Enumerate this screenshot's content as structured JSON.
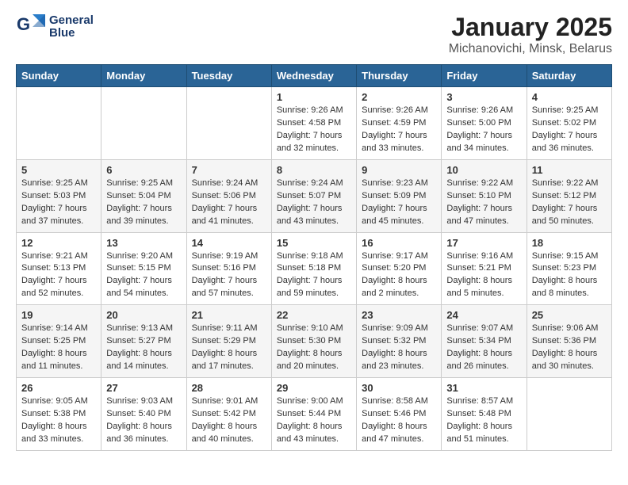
{
  "header": {
    "logo_line1": "General",
    "logo_line2": "Blue",
    "title": "January 2025",
    "subtitle": "Michanovichi, Minsk, Belarus"
  },
  "days_of_week": [
    "Sunday",
    "Monday",
    "Tuesday",
    "Wednesday",
    "Thursday",
    "Friday",
    "Saturday"
  ],
  "weeks": [
    [
      {
        "day": "",
        "content": ""
      },
      {
        "day": "",
        "content": ""
      },
      {
        "day": "",
        "content": ""
      },
      {
        "day": "1",
        "content": "Sunrise: 9:26 AM\nSunset: 4:58 PM\nDaylight: 7 hours\nand 32 minutes."
      },
      {
        "day": "2",
        "content": "Sunrise: 9:26 AM\nSunset: 4:59 PM\nDaylight: 7 hours\nand 33 minutes."
      },
      {
        "day": "3",
        "content": "Sunrise: 9:26 AM\nSunset: 5:00 PM\nDaylight: 7 hours\nand 34 minutes."
      },
      {
        "day": "4",
        "content": "Sunrise: 9:25 AM\nSunset: 5:02 PM\nDaylight: 7 hours\nand 36 minutes."
      }
    ],
    [
      {
        "day": "5",
        "content": "Sunrise: 9:25 AM\nSunset: 5:03 PM\nDaylight: 7 hours\nand 37 minutes."
      },
      {
        "day": "6",
        "content": "Sunrise: 9:25 AM\nSunset: 5:04 PM\nDaylight: 7 hours\nand 39 minutes."
      },
      {
        "day": "7",
        "content": "Sunrise: 9:24 AM\nSunset: 5:06 PM\nDaylight: 7 hours\nand 41 minutes."
      },
      {
        "day": "8",
        "content": "Sunrise: 9:24 AM\nSunset: 5:07 PM\nDaylight: 7 hours\nand 43 minutes."
      },
      {
        "day": "9",
        "content": "Sunrise: 9:23 AM\nSunset: 5:09 PM\nDaylight: 7 hours\nand 45 minutes."
      },
      {
        "day": "10",
        "content": "Sunrise: 9:22 AM\nSunset: 5:10 PM\nDaylight: 7 hours\nand 47 minutes."
      },
      {
        "day": "11",
        "content": "Sunrise: 9:22 AM\nSunset: 5:12 PM\nDaylight: 7 hours\nand 50 minutes."
      }
    ],
    [
      {
        "day": "12",
        "content": "Sunrise: 9:21 AM\nSunset: 5:13 PM\nDaylight: 7 hours\nand 52 minutes."
      },
      {
        "day": "13",
        "content": "Sunrise: 9:20 AM\nSunset: 5:15 PM\nDaylight: 7 hours\nand 54 minutes."
      },
      {
        "day": "14",
        "content": "Sunrise: 9:19 AM\nSunset: 5:16 PM\nDaylight: 7 hours\nand 57 minutes."
      },
      {
        "day": "15",
        "content": "Sunrise: 9:18 AM\nSunset: 5:18 PM\nDaylight: 7 hours\nand 59 minutes."
      },
      {
        "day": "16",
        "content": "Sunrise: 9:17 AM\nSunset: 5:20 PM\nDaylight: 8 hours\nand 2 minutes."
      },
      {
        "day": "17",
        "content": "Sunrise: 9:16 AM\nSunset: 5:21 PM\nDaylight: 8 hours\nand 5 minutes."
      },
      {
        "day": "18",
        "content": "Sunrise: 9:15 AM\nSunset: 5:23 PM\nDaylight: 8 hours\nand 8 minutes."
      }
    ],
    [
      {
        "day": "19",
        "content": "Sunrise: 9:14 AM\nSunset: 5:25 PM\nDaylight: 8 hours\nand 11 minutes."
      },
      {
        "day": "20",
        "content": "Sunrise: 9:13 AM\nSunset: 5:27 PM\nDaylight: 8 hours\nand 14 minutes."
      },
      {
        "day": "21",
        "content": "Sunrise: 9:11 AM\nSunset: 5:29 PM\nDaylight: 8 hours\nand 17 minutes."
      },
      {
        "day": "22",
        "content": "Sunrise: 9:10 AM\nSunset: 5:30 PM\nDaylight: 8 hours\nand 20 minutes."
      },
      {
        "day": "23",
        "content": "Sunrise: 9:09 AM\nSunset: 5:32 PM\nDaylight: 8 hours\nand 23 minutes."
      },
      {
        "day": "24",
        "content": "Sunrise: 9:07 AM\nSunset: 5:34 PM\nDaylight: 8 hours\nand 26 minutes."
      },
      {
        "day": "25",
        "content": "Sunrise: 9:06 AM\nSunset: 5:36 PM\nDaylight: 8 hours\nand 30 minutes."
      }
    ],
    [
      {
        "day": "26",
        "content": "Sunrise: 9:05 AM\nSunset: 5:38 PM\nDaylight: 8 hours\nand 33 minutes."
      },
      {
        "day": "27",
        "content": "Sunrise: 9:03 AM\nSunset: 5:40 PM\nDaylight: 8 hours\nand 36 minutes."
      },
      {
        "day": "28",
        "content": "Sunrise: 9:01 AM\nSunset: 5:42 PM\nDaylight: 8 hours\nand 40 minutes."
      },
      {
        "day": "29",
        "content": "Sunrise: 9:00 AM\nSunset: 5:44 PM\nDaylight: 8 hours\nand 43 minutes."
      },
      {
        "day": "30",
        "content": "Sunrise: 8:58 AM\nSunset: 5:46 PM\nDaylight: 8 hours\nand 47 minutes."
      },
      {
        "day": "31",
        "content": "Sunrise: 8:57 AM\nSunset: 5:48 PM\nDaylight: 8 hours\nand 51 minutes."
      },
      {
        "day": "",
        "content": ""
      }
    ]
  ]
}
